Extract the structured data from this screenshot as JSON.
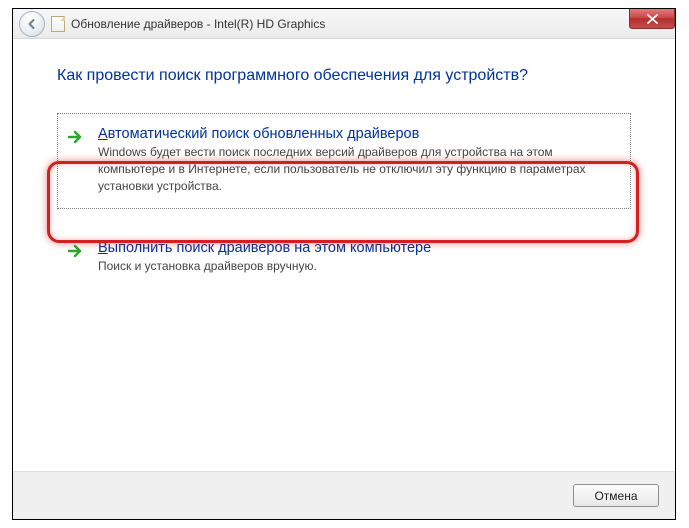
{
  "titlebar": {
    "title": "Обновление драйверов - Intel(R) HD Graphics"
  },
  "heading": "Как провести поиск программного обеспечения для устройств?",
  "options": [
    {
      "title_first": "А",
      "title_rest": "втоматический поиск обновленных драйверов",
      "desc": "Windows будет вести поиск последних версий драйверов для устройства на этом компьютере и в Интернете, если пользователь не отключил эту функцию в параметрах установки устройства."
    },
    {
      "title_first": "В",
      "title_rest": "ыполнить поиск драйверов на этом компьютере",
      "desc": "Поиск и установка драйверов вручную."
    }
  ],
  "footer": {
    "cancel": "Отмена"
  }
}
